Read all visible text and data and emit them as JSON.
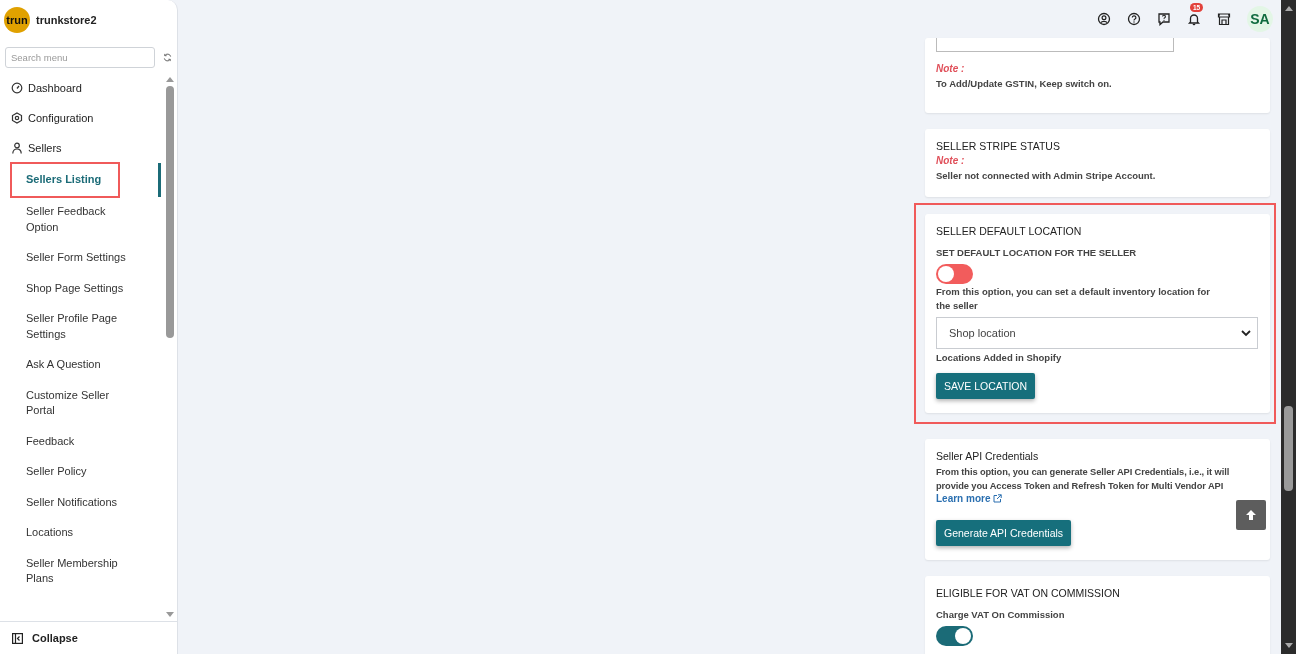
{
  "brand": {
    "logo_text": "trun",
    "name": "trunkstore2"
  },
  "search": {
    "placeholder": "Search menu"
  },
  "menu": [
    {
      "label": "Dashboard",
      "kind": "dashboard"
    },
    {
      "label": "Configuration",
      "kind": "configuration"
    },
    {
      "label": "Sellers",
      "kind": "sellers",
      "expanded": true,
      "children": [
        {
          "label": "Sellers Listing",
          "selected": true,
          "highlighted": true
        },
        {
          "label": "Seller Feedback Option",
          "selected": false,
          "highlighted": false
        },
        {
          "label": "Seller Form Settings",
          "selected": false,
          "highlighted": false
        },
        {
          "label": "Shop Page Settings",
          "selected": false,
          "highlighted": false
        },
        {
          "label": "Seller Profile Page Settings",
          "selected": false,
          "highlighted": false
        },
        {
          "label": "Ask A Question",
          "selected": false,
          "highlighted": false
        },
        {
          "label": "Customize Seller Portal",
          "selected": false,
          "highlighted": false
        },
        {
          "label": "Feedback",
          "selected": false,
          "highlighted": false
        },
        {
          "label": "Seller Policy",
          "selected": false,
          "highlighted": false
        },
        {
          "label": "Seller Notifications",
          "selected": false,
          "highlighted": false
        },
        {
          "label": "Locations",
          "selected": false,
          "highlighted": false
        },
        {
          "label": "Seller Membership Plans",
          "selected": false,
          "highlighted": false
        }
      ]
    }
  ],
  "collapse": {
    "label": "Collapse"
  },
  "topbar": {
    "notification_count": "15",
    "avatar": "SA"
  },
  "cards": [
    {
      "highlighted": false,
      "blocks": [
        {
          "kind": "field"
        },
        {
          "kind": "note",
          "text": "Note :"
        },
        {
          "kind": "text",
          "text": "To Add/Update GSTIN, Keep switch on."
        }
      ]
    },
    {
      "highlighted": false,
      "blocks": [
        {
          "kind": "title",
          "text": "SELLER STRIPE STATUS"
        },
        {
          "kind": "note",
          "text": "Note :"
        },
        {
          "kind": "text",
          "text": "Seller not connected with Admin Stripe Account."
        }
      ]
    },
    {
      "highlighted": true,
      "blocks": [
        {
          "kind": "title",
          "text": "SELLER DEFAULT LOCATION"
        },
        {
          "kind": "label",
          "text": "SET DEFAULT LOCATION FOR THE SELLER"
        },
        {
          "kind": "toggle",
          "on": false
        },
        {
          "kind": "text",
          "text": "From this option, you can set a default inventory location for the seller"
        },
        {
          "kind": "select",
          "text": "Shop location"
        },
        {
          "kind": "text",
          "text": "Locations Added in Shopify"
        },
        {
          "kind": "button",
          "text": "SAVE LOCATION"
        }
      ]
    },
    {
      "highlighted": false,
      "blocks": [
        {
          "kind": "title",
          "text": "Seller API Credentials"
        },
        {
          "kind": "text",
          "text": "From this option, you can generate Seller API Credentials, i.e., it will provide you Access Token and Refresh Token for Multi Vendor API"
        },
        {
          "kind": "link",
          "text": "Learn more"
        },
        {
          "kind": "button",
          "text": "Generate API Credentials"
        }
      ]
    },
    {
      "highlighted": false,
      "blocks": [
        {
          "kind": "title",
          "text": "ELIGIBLE FOR VAT ON COMMISSION"
        },
        {
          "kind": "label",
          "text": "Charge VAT On Commission"
        },
        {
          "kind": "toggle",
          "on": true
        }
      ]
    }
  ]
}
